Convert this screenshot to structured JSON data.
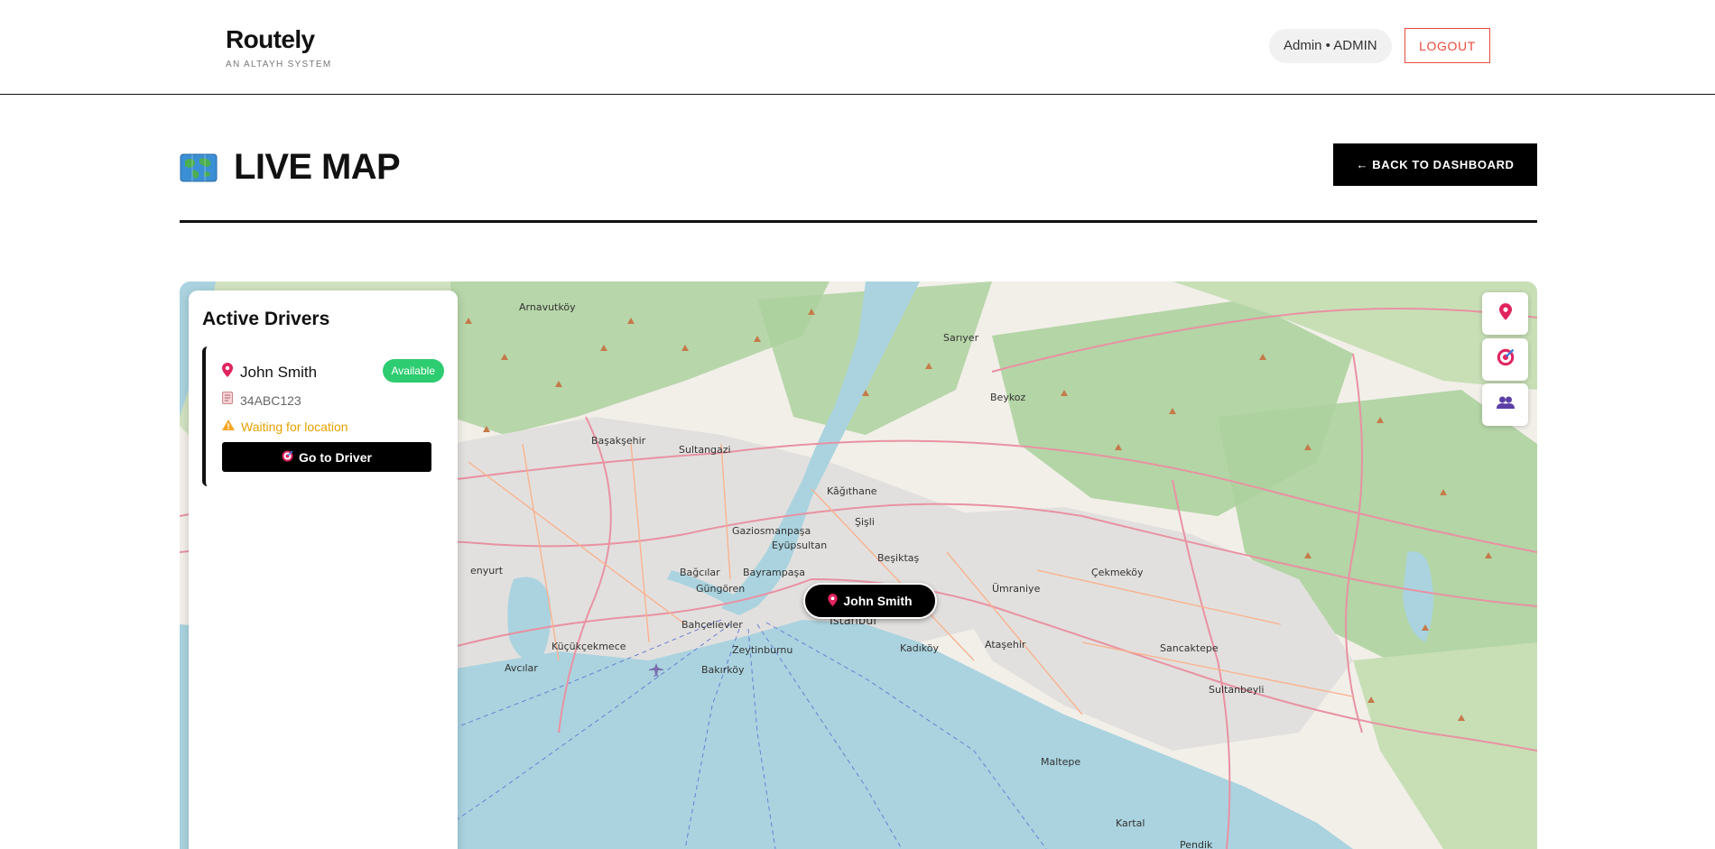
{
  "header": {
    "brand": "Routely",
    "brand_sub": "AN ALTAYH SYSTEM",
    "user_pill": "Admin • ADMIN",
    "logout_label": "LOGOUT"
  },
  "page": {
    "title": "LIVE MAP",
    "back_label": "← BACK TO DASHBOARD"
  },
  "drivers_panel": {
    "title": "Active Drivers",
    "drivers": [
      {
        "name": "John Smith",
        "status": "Available",
        "plate": "34ABC123",
        "location_note": "Waiting for location",
        "action_label": "Go to Driver"
      }
    ]
  },
  "map": {
    "marker_label": "John Smith",
    "places": {
      "arnavutkoy": "Arnavutköy",
      "sariyer": "Sarıyer",
      "beykoz": "Beykoz",
      "basaksehir": "Başakşehir",
      "sultangazi": "Sultangazi",
      "kagithane": "Kâğıthane",
      "sisli": "Şişli",
      "gaziosmanpasa": "Gaziosmanpaşa",
      "eyupsultan": "Eyüpsultan",
      "besiktas": "Beşiktaş",
      "bagcilar": "Bağcılar",
      "bayrampasa": "Bayrampaşa",
      "gungoren": "Güngören",
      "umraniye": "Ümraniye",
      "cekmekoy": "Çekmeköy",
      "istanbul": "İstanbul",
      "bahcelievler": "Bahçelievler",
      "kucukcekmece": "Küçükçekmece",
      "zeytinburnu": "Zeytinburnu",
      "kadikoy": "Kadıköy",
      "atasehir": "Ataşehir",
      "sancaktepe": "Sancaktepe",
      "avcilar": "Avcılar",
      "bakirkoy": "Bakırköy",
      "sultanbeyli": "Sultanbeyli",
      "maltepe": "Maltepe",
      "kartal": "Kartal",
      "pendik": "Pendik",
      "esenyurt": "enyurt"
    },
    "colors": {
      "water": "#aad3df",
      "land": "#f2efe9",
      "forest": "#add19e",
      "urban": "#e0dfdf",
      "road": "#e892a2",
      "major_road": "#f9b28f"
    }
  }
}
